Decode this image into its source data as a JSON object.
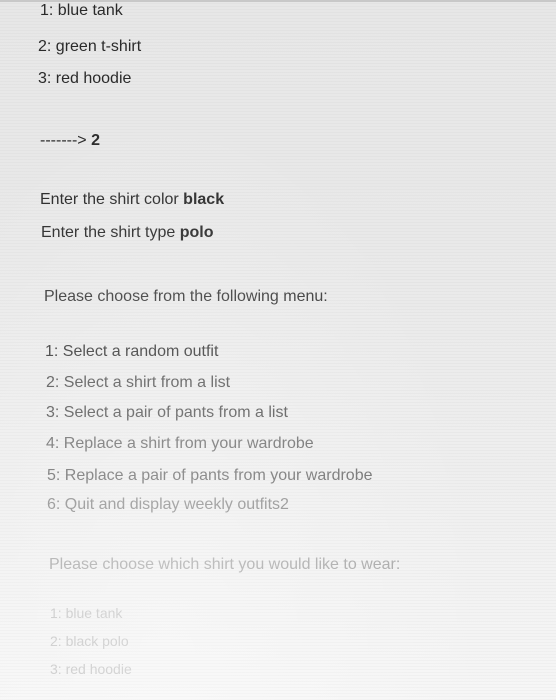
{
  "console": {
    "prev_list": [
      "1: blue tank",
      "2: green t-shirt",
      "3: red hoodie"
    ],
    "prompt_arrow": "-------> ",
    "prompt_value": "2",
    "color_prompt": "Enter the shirt color ",
    "color_value": "black",
    "type_prompt": "Enter the shirt type ",
    "type_value": "polo",
    "menu_header": "Please choose from the following menu:",
    "menu_items": [
      "1: Select a random outfit",
      "2: Select a shirt from a list",
      "3: Select a pair of pants from a list",
      "4: Replace a shirt from your wardrobe",
      "5: Replace a pair of pants from your wardrobe",
      "6: Quit and display weekly outfits2"
    ],
    "shirt_question": "Please choose which shirt you would like to wear:",
    "shirt_list": [
      "1: blue tank",
      "2: black polo",
      "3: red hoodie"
    ]
  }
}
